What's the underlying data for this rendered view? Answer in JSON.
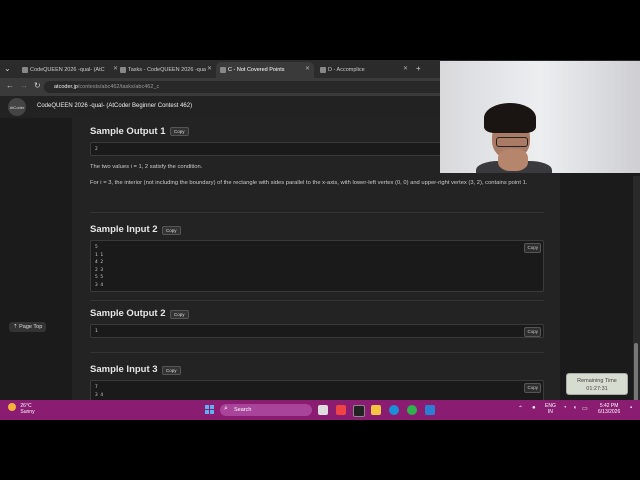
{
  "browser": {
    "tabs": [
      {
        "label": "CodeQUEEN 2026 -qual- (AtC",
        "active": false
      },
      {
        "label": "Tasks - CodeQUEEN 2026 -qua",
        "active": false
      },
      {
        "label": "C - Not Covered Points",
        "active": true
      },
      {
        "label": "D - Accomplice",
        "active": false
      }
    ],
    "url_host": "atcoder.jp",
    "url_path": "/contests/abc462/tasks/abc462_c"
  },
  "site": {
    "logo_text": "AtCoder",
    "contest_title": "CodeQUEEN 2026 -qual- (AtCoder Beginner Contest 462)"
  },
  "content": {
    "copy_label": "Copy",
    "sections": [
      {
        "title": "Sample Output 1",
        "lines": [
          "2"
        ]
      },
      {
        "title": "Sample Input 2",
        "lines": [
          "5",
          "1 1",
          "4 2",
          "2 3",
          "5 5",
          "3 4"
        ]
      },
      {
        "title": "Sample Output 2",
        "lines": [
          "1"
        ]
      },
      {
        "title": "Sample Input 3",
        "lines": [
          "7",
          "3 4"
        ]
      }
    ],
    "explanation": [
      "The two values i = 1, 2 satisfy the condition.",
      "For i = 3, the interior (not including the boundary) of the rectangle with sides parallel to the x-axis, with lower-left vertex (0, 0) and upper-right vertex (3, 2), contains point 1."
    ],
    "page_top": "Page Top"
  },
  "timer": {
    "label": "Remaining Time",
    "value": "01:27:31"
  },
  "taskbar": {
    "weather_temp": "26°C",
    "weather_desc": "Sunny",
    "search_placeholder": "Search",
    "lang_top": "ENG",
    "lang_bottom": "IN",
    "time": "5:42 PM",
    "date": "6/13/2026"
  },
  "colors": {
    "taskbar": "#8a1c72",
    "page_bg": "#1b1b1b",
    "accent": "#5db1f3"
  }
}
